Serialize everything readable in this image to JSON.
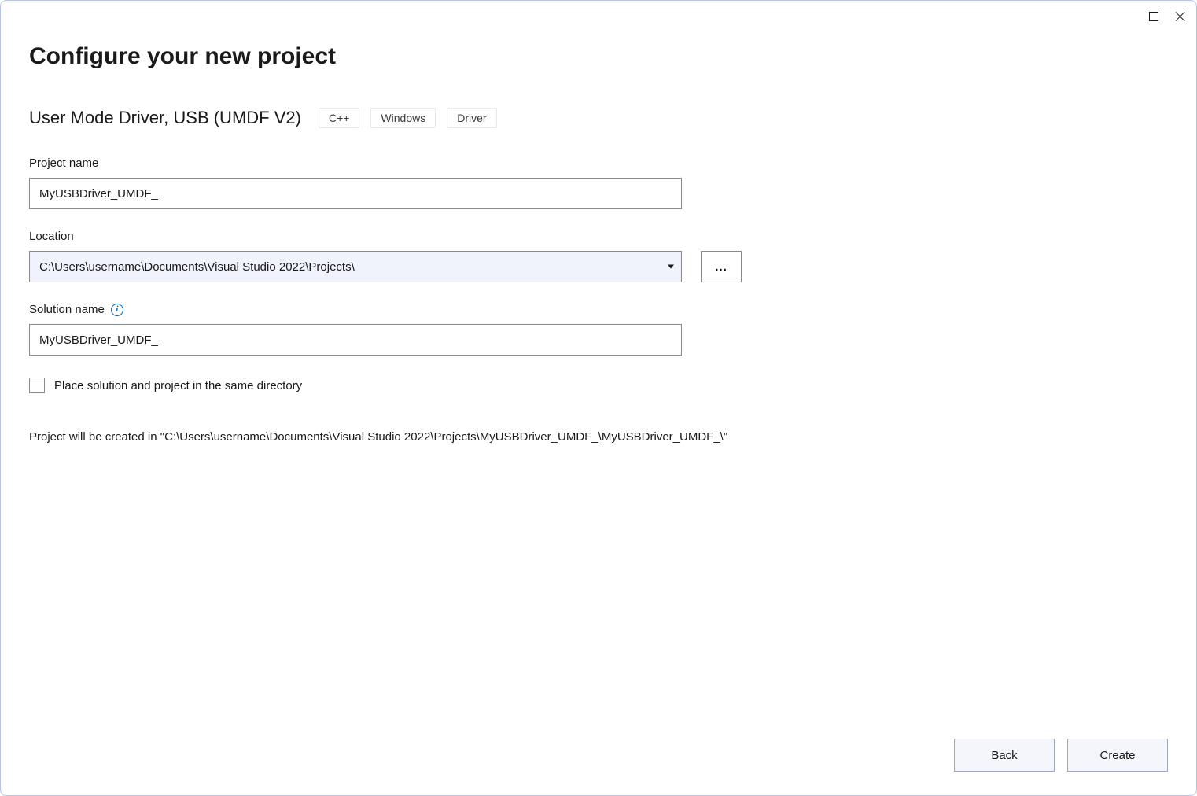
{
  "window": {
    "title": "Configure your new project"
  },
  "template": {
    "name": "User Mode Driver, USB (UMDF V2)",
    "tags": [
      "C++",
      "Windows",
      "Driver"
    ]
  },
  "fields": {
    "projectName": {
      "label": "Project name",
      "value": "MyUSBDriver_UMDF_"
    },
    "location": {
      "label": "Location",
      "value": "C:\\Users\\username\\Documents\\Visual Studio 2022\\Projects\\",
      "browseLabel": "..."
    },
    "solutionName": {
      "label": "Solution name",
      "value": "MyUSBDriver_UMDF_"
    },
    "sameDirectory": {
      "label": "Place solution and project in the same directory",
      "checked": false
    }
  },
  "info": {
    "pathText": "Project will be created in \"C:\\Users\\username\\Documents\\Visual Studio 2022\\Projects\\MyUSBDriver_UMDF_\\MyUSBDriver_UMDF_\\\""
  },
  "buttons": {
    "back": "Back",
    "create": "Create"
  }
}
